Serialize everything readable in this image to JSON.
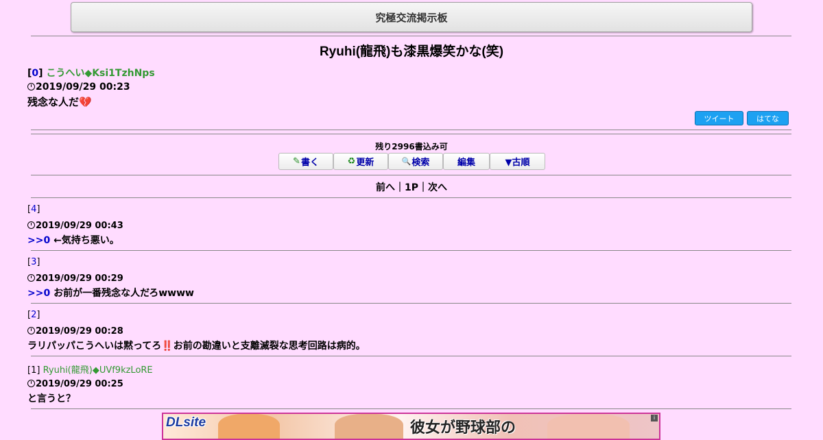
{
  "header": {
    "site_title": "究極交流掲示板"
  },
  "thread": {
    "title": "Ryuhi(龍飛)も漆黒爆笑かな(笑)"
  },
  "first_post": {
    "num": "0",
    "author": "こうへい◆Ksi1TzhNps",
    "datetime": "2019/09/29 00:23",
    "body": "残念な人だ",
    "emoji": "💔"
  },
  "share": {
    "tweet_label": "ツイート",
    "hatena_label": "はてな"
  },
  "status": {
    "remaining": "残り2996書込み可"
  },
  "toolbar": {
    "write_label": "書く",
    "refresh_label": "更新",
    "search_label": "検索",
    "edit_label": "編集",
    "order_label": "▼古順"
  },
  "pager": {
    "prev": "前へ",
    "sep1": "｜",
    "page": "1P",
    "sep2": "｜",
    "next": "次へ"
  },
  "replies": [
    {
      "num": "4",
      "author": "",
      "datetime": "2019/09/29 00:43",
      "anchor": ">>0",
      "body": "←気持ち悪い。"
    },
    {
      "num": "3",
      "author": "",
      "datetime": "2019/09/29 00:29",
      "anchor": ">>0",
      "body": "お前が一番残念な人だろwwww"
    },
    {
      "num": "2",
      "author": "",
      "datetime": "2019/09/29 00:28",
      "anchor": "",
      "body": "ラリパッパこうへいは黙ってろ‼️お前の勘違いと支離滅裂な思考回路は病的。"
    },
    {
      "num": "1",
      "author": "Ryuhi(龍飛)◆UVf9kzLoRE",
      "datetime": "2019/09/29 00:25",
      "anchor": "",
      "body": "と言うと？"
    }
  ],
  "ad": {
    "logo": "DLsite",
    "title": "彼女が野球部の",
    "info": "i"
  },
  "colors": {
    "background": "#ffdcff",
    "link": "#0000cc",
    "author": "#339933",
    "share": "#1da1f2",
    "ad_border": "#cc3399"
  }
}
